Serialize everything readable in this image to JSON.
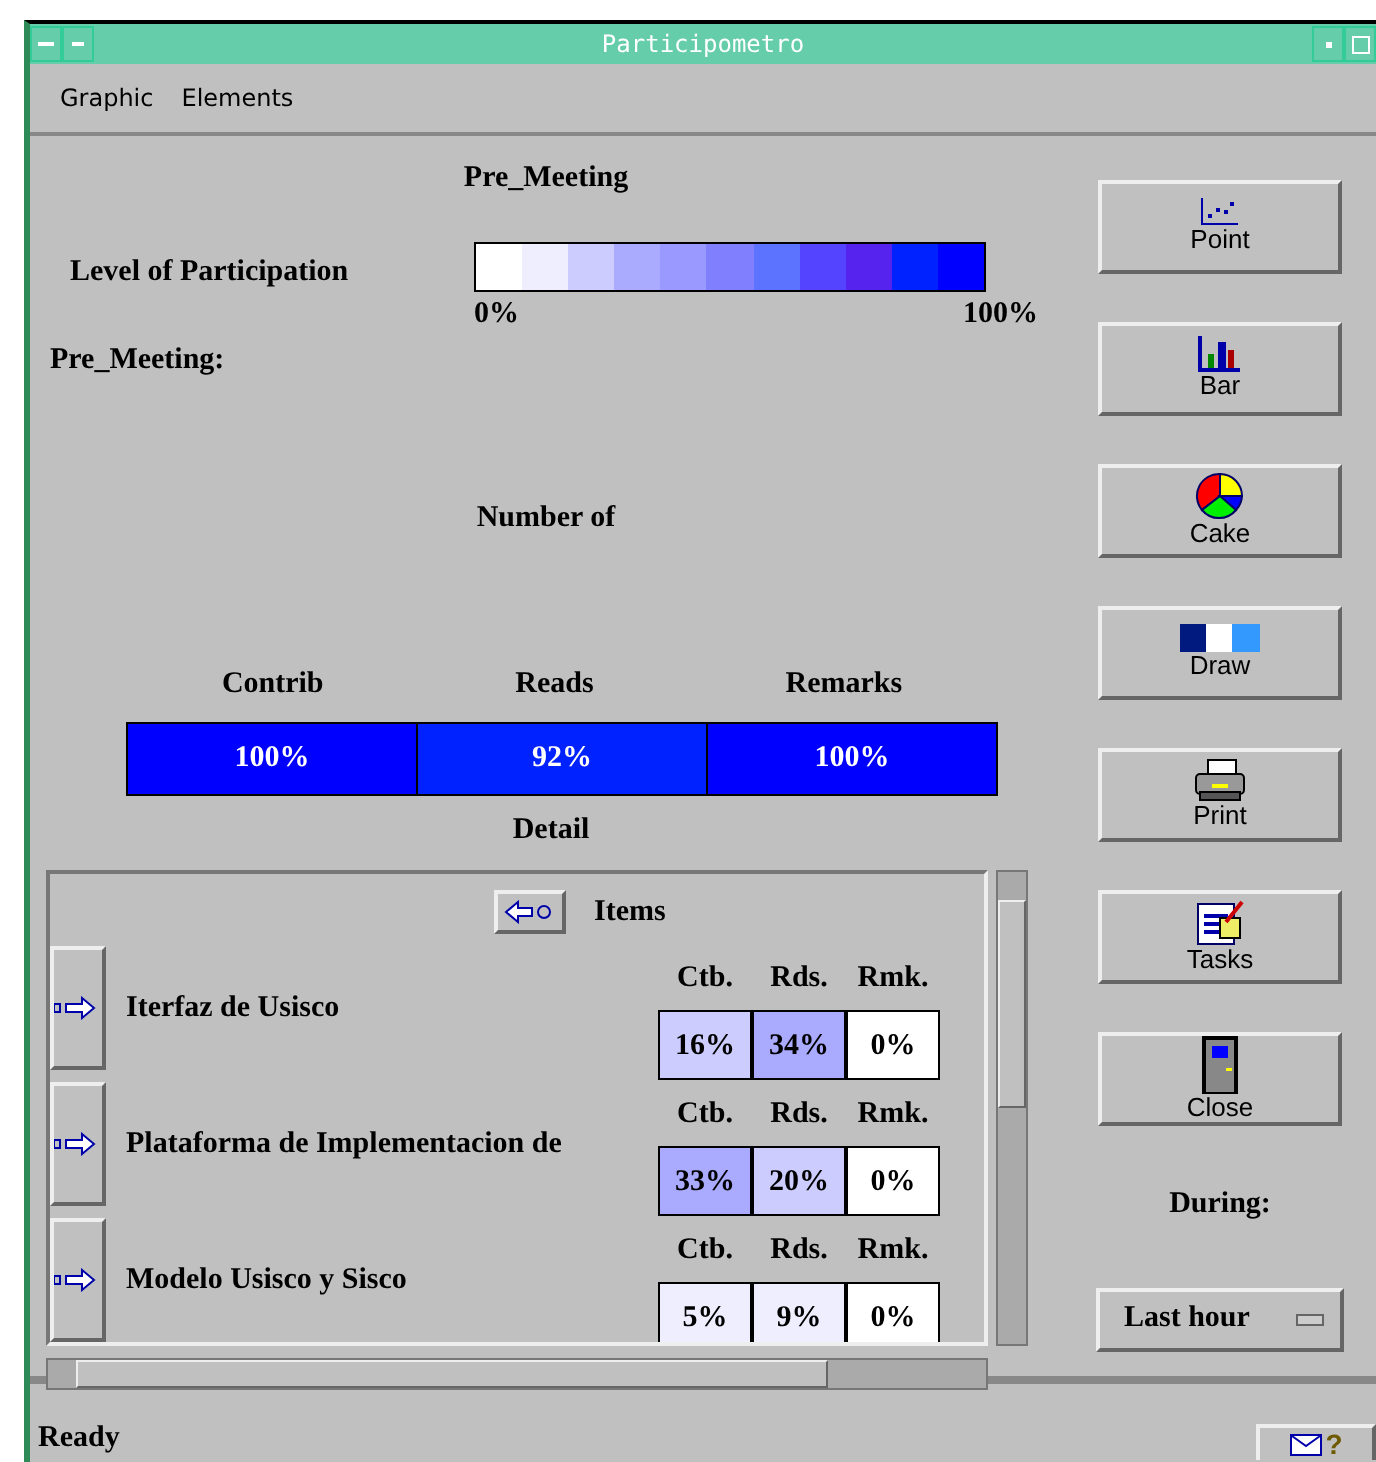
{
  "window": {
    "title": "Participometro"
  },
  "menu": [
    {
      "label": "Graphic"
    },
    {
      "label": "Elements"
    }
  ],
  "meeting_title": "Pre_Meeting",
  "legend": {
    "label": "Level of Participation",
    "min_label": "0%",
    "max_label": "100%"
  },
  "section_label": "Pre_Meeting:",
  "number_label": "Number of",
  "totals": [
    {
      "name": "Contrib",
      "value": "100%",
      "color": "#0000ff"
    },
    {
      "name": "Reads",
      "value": "92%",
      "color": "#0022ff"
    },
    {
      "name": "Remarks",
      "value": "100%",
      "color": "#0000ff"
    }
  ],
  "detail_label": "Detail",
  "items_header": "Items",
  "items": [
    {
      "name": "Iterfaz de Usisco",
      "metrics": [
        {
          "header": "Ctb.",
          "value": "16%",
          "color": "#ccccff"
        },
        {
          "header": "Rds.",
          "value": "34%",
          "color": "#aaaaff"
        },
        {
          "header": "Rmk.",
          "value": "0%",
          "color": "#ffffff"
        }
      ]
    },
    {
      "name": "Plataforma de Implementacion de",
      "metrics": [
        {
          "header": "Ctb.",
          "value": "33%",
          "color": "#aaaaff"
        },
        {
          "header": "Rds.",
          "value": "20%",
          "color": "#ccccff"
        },
        {
          "header": "Rmk.",
          "value": "0%",
          "color": "#ffffff"
        }
      ]
    },
    {
      "name": "Modelo Usisco y Sisco",
      "metrics": [
        {
          "header": "Ctb.",
          "value": "5%",
          "color": "#eeeeff"
        },
        {
          "header": "Rds.",
          "value": "9%",
          "color": "#eeeeff"
        },
        {
          "header": "Rmk.",
          "value": "0%",
          "color": "#ffffff"
        }
      ]
    }
  ],
  "tools": [
    {
      "label": "Point",
      "kind": "point"
    },
    {
      "label": "Bar",
      "kind": "bar"
    },
    {
      "label": "Cake",
      "kind": "cake"
    },
    {
      "label": "Draw",
      "kind": "draw"
    },
    {
      "label": "Print",
      "kind": "print"
    },
    {
      "label": "Tasks",
      "kind": "tasks"
    },
    {
      "label": "Close",
      "kind": "close"
    }
  ],
  "during_label": "During:",
  "period": {
    "value": "Last hour"
  },
  "status_bar": "Ready",
  "help_button": "?"
}
